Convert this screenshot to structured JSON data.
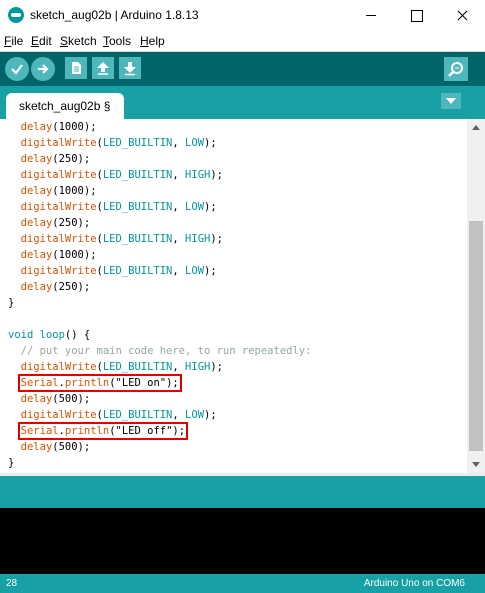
{
  "window": {
    "title": "sketch_aug02b | Arduino 1.8.13"
  },
  "menu": [
    {
      "mnemonic": "F",
      "rest": "ile"
    },
    {
      "mnemonic": "E",
      "rest": "dit"
    },
    {
      "mnemonic": "S",
      "rest": "ketch"
    },
    {
      "mnemonic": "T",
      "rest": "ools"
    },
    {
      "mnemonic": "H",
      "rest": "elp"
    }
  ],
  "toolbar": {
    "buttons": [
      "verify-icon",
      "upload-icon",
      "new-icon",
      "open-icon",
      "save-icon"
    ],
    "serial_monitor": "magnifier-icon"
  },
  "tab": {
    "label": "sketch_aug02b §"
  },
  "code": {
    "lines": [
      [
        {
          "t": "  "
        },
        {
          "t": "delay",
          "c": "o"
        },
        {
          "t": "(1000);"
        }
      ],
      [
        {
          "t": "  "
        },
        {
          "t": "digitalWrite",
          "c": "o"
        },
        {
          "t": "("
        },
        {
          "t": "LED_BUILTIN",
          "c": "t"
        },
        {
          "t": ", "
        },
        {
          "t": "LOW",
          "c": "t"
        },
        {
          "t": ");"
        }
      ],
      [
        {
          "t": "  "
        },
        {
          "t": "delay",
          "c": "o"
        },
        {
          "t": "(250);"
        }
      ],
      [
        {
          "t": "  "
        },
        {
          "t": "digitalWrite",
          "c": "o"
        },
        {
          "t": "("
        },
        {
          "t": "LED_BUILTIN",
          "c": "t"
        },
        {
          "t": ", "
        },
        {
          "t": "HIGH",
          "c": "t"
        },
        {
          "t": ");"
        }
      ],
      [
        {
          "t": "  "
        },
        {
          "t": "delay",
          "c": "o"
        },
        {
          "t": "(1000);"
        }
      ],
      [
        {
          "t": "  "
        },
        {
          "t": "digitalWrite",
          "c": "o"
        },
        {
          "t": "("
        },
        {
          "t": "LED_BUILTIN",
          "c": "t"
        },
        {
          "t": ", "
        },
        {
          "t": "LOW",
          "c": "t"
        },
        {
          "t": ");"
        }
      ],
      [
        {
          "t": "  "
        },
        {
          "t": "delay",
          "c": "o"
        },
        {
          "t": "(250);"
        }
      ],
      [
        {
          "t": "  "
        },
        {
          "t": "digitalWrite",
          "c": "o"
        },
        {
          "t": "("
        },
        {
          "t": "LED_BUILTIN",
          "c": "t"
        },
        {
          "t": ", "
        },
        {
          "t": "HIGH",
          "c": "t"
        },
        {
          "t": ");"
        }
      ],
      [
        {
          "t": "  "
        },
        {
          "t": "delay",
          "c": "o"
        },
        {
          "t": "(1000);"
        }
      ],
      [
        {
          "t": "  "
        },
        {
          "t": "digitalWrite",
          "c": "o"
        },
        {
          "t": "("
        },
        {
          "t": "LED_BUILTIN",
          "c": "t"
        },
        {
          "t": ", "
        },
        {
          "t": "LOW",
          "c": "t"
        },
        {
          "t": ");"
        }
      ],
      [
        {
          "t": "  "
        },
        {
          "t": "delay",
          "c": "o"
        },
        {
          "t": "(250);"
        }
      ],
      [
        {
          "t": "}"
        }
      ],
      [],
      [
        {
          "t": "void",
          "c": "t"
        },
        {
          "t": " "
        },
        {
          "t": "loop",
          "c": "t"
        },
        {
          "t": "() {"
        }
      ],
      [
        {
          "t": "  // put your main code here, to run repeatedly:",
          "c": "g"
        }
      ],
      [
        {
          "t": "  "
        },
        {
          "t": "digitalWrite",
          "c": "o"
        },
        {
          "t": "("
        },
        {
          "t": "LED_BUILTIN",
          "c": "t"
        },
        {
          "t": ", "
        },
        {
          "t": "HIGH",
          "c": "t"
        },
        {
          "t": ");"
        }
      ],
      [
        {
          "t": "  "
        },
        {
          "t": "Serial",
          "c": "o"
        },
        {
          "t": "."
        },
        {
          "t": "println",
          "c": "o"
        },
        {
          "t": "(\"LED on\");"
        }
      ],
      [
        {
          "t": "  "
        },
        {
          "t": "delay",
          "c": "o"
        },
        {
          "t": "(500);"
        }
      ],
      [
        {
          "t": "  "
        },
        {
          "t": "digitalWrite",
          "c": "o"
        },
        {
          "t": "("
        },
        {
          "t": "LED_BUILTIN",
          "c": "t"
        },
        {
          "t": ", "
        },
        {
          "t": "LOW",
          "c": "t"
        },
        {
          "t": ");"
        }
      ],
      [
        {
          "t": "  "
        },
        {
          "t": "Serial",
          "c": "o"
        },
        {
          "t": "."
        },
        {
          "t": "println",
          "c": "o"
        },
        {
          "t": "(\"LED off\");"
        }
      ],
      [
        {
          "t": "  "
        },
        {
          "t": "delay",
          "c": "o"
        },
        {
          "t": "(500);"
        }
      ],
      [
        {
          "t": "}"
        }
      ]
    ],
    "highlighted_lines": [
      16,
      19
    ]
  },
  "status": {
    "line_number": "28",
    "board": "Arduino Uno on COM6"
  },
  "colors": {
    "toolbar": "#006468",
    "tabstrip": "#17a1a5",
    "button": "#4db7bb",
    "keyword_orange": "#d35400",
    "keyword_teal": "#00979c",
    "comment": "#95a5a6",
    "highlight": "#e00000"
  }
}
